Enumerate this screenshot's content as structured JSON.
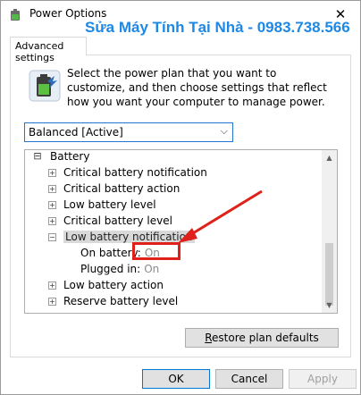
{
  "window": {
    "title": "Power Options",
    "close_glyph": "✕"
  },
  "watermark": "Sửa Máy Tính Tại Nhà - 0983.738.566",
  "tab": {
    "label": "Advanced settings"
  },
  "description": "Select the power plan that you want to customize, and then choose settings that reflect how you want your computer to manage power.",
  "plan": {
    "selected": "Balanced [Active]",
    "arrow": "⌵"
  },
  "tree": {
    "root": {
      "label": "Battery",
      "expander": "⊟"
    },
    "items": [
      {
        "label": "Critical battery notification",
        "expander": "+"
      },
      {
        "label": "Critical battery action",
        "expander": "+"
      },
      {
        "label": "Low battery level",
        "expander": "+"
      },
      {
        "label": "Critical battery level",
        "expander": "+"
      },
      {
        "label": "Low battery notification",
        "expander": "−"
      },
      {
        "label": "Low battery action",
        "expander": "+"
      },
      {
        "label": "Reserve battery level",
        "expander": "+"
      }
    ],
    "sub": [
      {
        "label": "On battery:",
        "value": "On"
      },
      {
        "label": "Plugged in:",
        "value": "On"
      }
    ]
  },
  "scroll": {
    "up": "▲",
    "down": "▼"
  },
  "buttons": {
    "restore_first": "R",
    "restore_rest": "estore plan defaults",
    "ok": "OK",
    "cancel": "Cancel",
    "apply": "Apply"
  },
  "colors": {
    "accent": "#0078d7",
    "annotation": "#e0201b",
    "watermark": "#1e88e5"
  },
  "icons": {
    "title": "power-options-icon",
    "battery": "battery-power-icon",
    "close": "close-icon"
  }
}
